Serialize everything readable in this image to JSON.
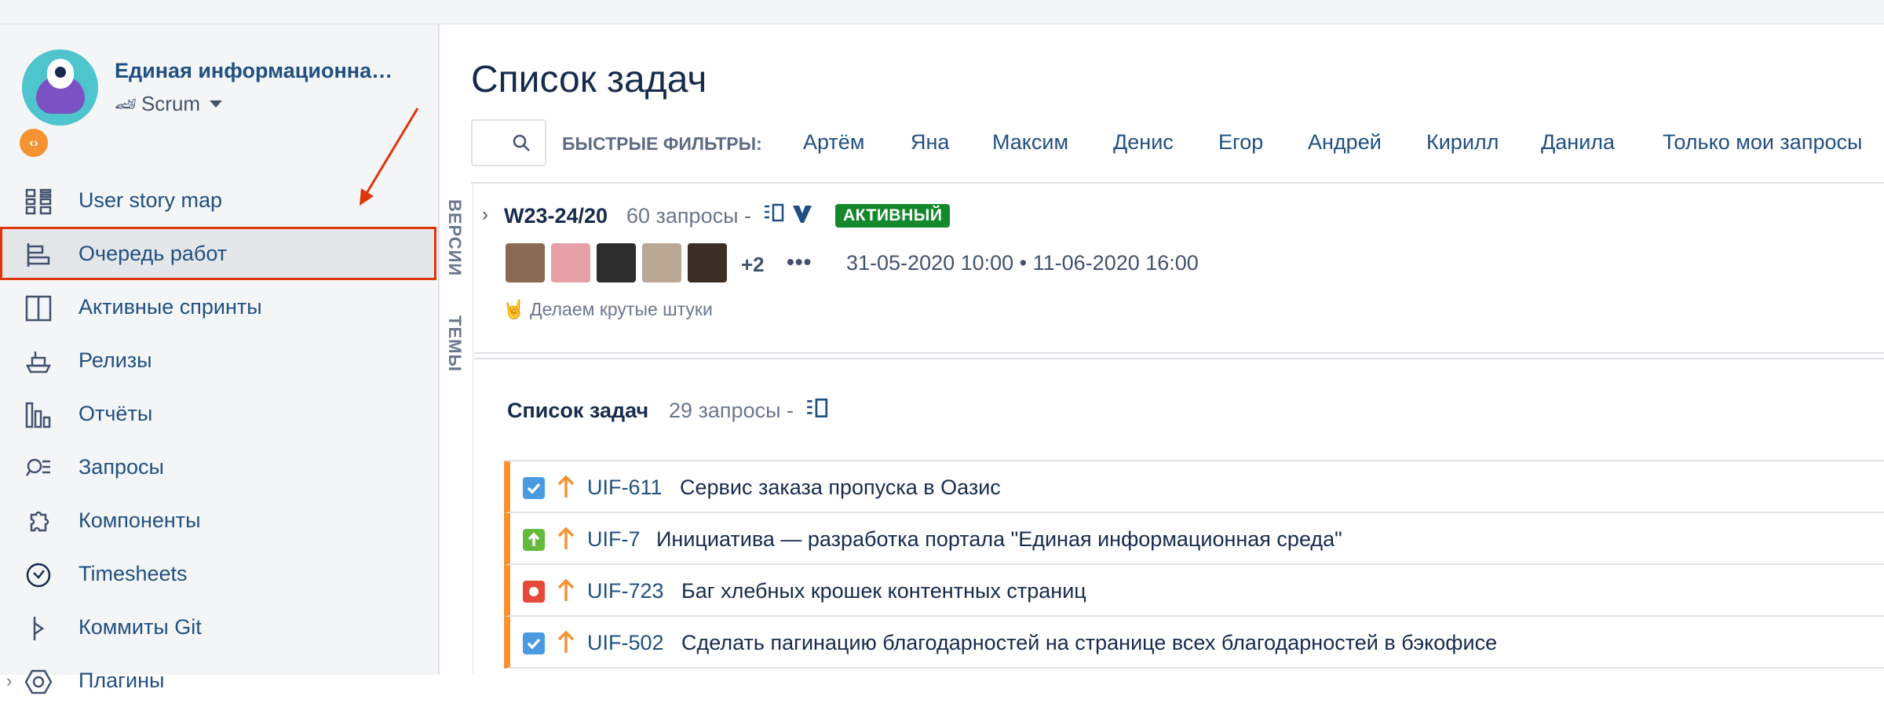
{
  "project": {
    "name": "Единая информационна…",
    "board_type": "Scrum",
    "badge": "‹›"
  },
  "sidebar": {
    "items": [
      {
        "label": "User story map",
        "icon": "grid-icon"
      },
      {
        "label": "Очередь работ",
        "icon": "backlog-icon",
        "active": true
      },
      {
        "label": "Активные спринты",
        "icon": "board-icon"
      },
      {
        "label": "Релизы",
        "icon": "ship-icon"
      },
      {
        "label": "Отчёты",
        "icon": "reports-icon"
      },
      {
        "label": "Запросы",
        "icon": "issues-search-icon"
      },
      {
        "label": "Компоненты",
        "icon": "puzzle-icon"
      },
      {
        "label": "Timesheets",
        "icon": "clock-icon"
      },
      {
        "label": "Коммиты Git",
        "icon": "git-commit-icon"
      },
      {
        "label": "Плагины",
        "icon": "hexagon-icon"
      }
    ]
  },
  "vertical_tabs": [
    "ВЕРСИИ",
    "ТЕМЫ"
  ],
  "main": {
    "title": "Список задач",
    "quick_filters_label": "БЫСТРЫЕ ФИЛЬТРЫ:",
    "quick_filters": [
      "Артём",
      "Яна",
      "Максим",
      "Денис",
      "Егор",
      "Андрей",
      "Кирилл",
      "Данила",
      "Только мои запросы"
    ]
  },
  "sprint": {
    "name": "W23-24/20",
    "count": "60 запросы -",
    "status": "АКТИВНЫЙ",
    "more_assignees": "+2",
    "dots": "•••",
    "dates": "31-05-2020 10:00  •  11-06-2020 16:00",
    "goal": "🤘 Делаем крутые штуки"
  },
  "backlog": {
    "title": "Список задач",
    "count": "29 запросы -",
    "issues": [
      {
        "key": "UIF-611",
        "summary": "Сервис заказа пропуска в Оазис",
        "type": "task"
      },
      {
        "key": "UIF-7",
        "summary": "Инициатива — разработка портала \"Единая информационная среда\"",
        "type": "story"
      },
      {
        "key": "UIF-723",
        "summary": "Баг хлебных крошек контентных страниц",
        "type": "bug"
      },
      {
        "key": "UIF-502",
        "summary": "Сделать пагинацию благодарностей на странице всех благодарностей в бэкофисе",
        "type": "task"
      }
    ]
  },
  "colors": {
    "link": "#205081",
    "active_badge": "#14892c",
    "priority": "#f79232",
    "highlight": "#de350b"
  }
}
